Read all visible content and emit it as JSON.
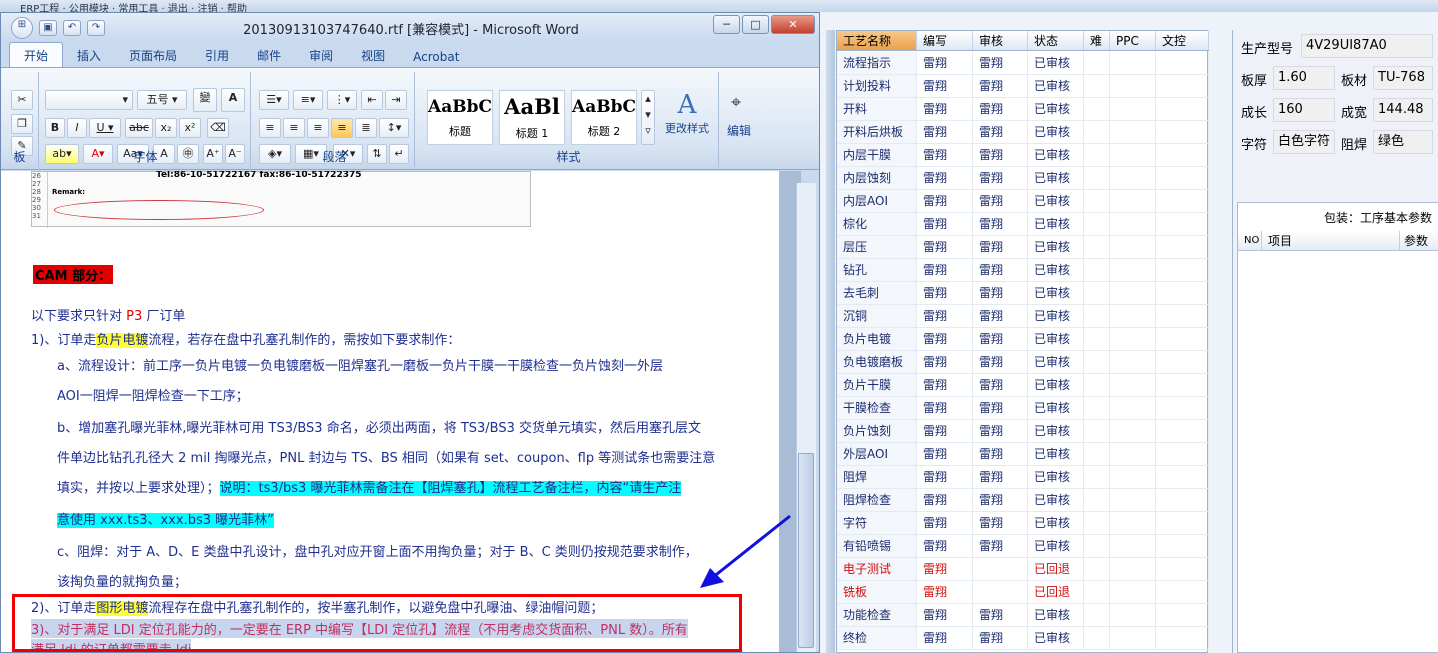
{
  "window": {
    "title": "20130913103747640.rtf [兼容模式] - Microsoft Word",
    "min": "─",
    "max": "□",
    "close": "✕"
  },
  "bg_menu": "ERP工程 · 公用模块 · 常用工具 · 退出 · 注销 · 帮助",
  "tabs": [
    "开始",
    "插入",
    "页面布局",
    "引用",
    "邮件",
    "审阅",
    "视图",
    "Acrobat"
  ],
  "ribbon": {
    "font_size": "五号",
    "groups": {
      "font": "字体",
      "paragraph": "段落",
      "styles": "样式",
      "clipboard": "板",
      "edit": "编辑"
    },
    "styles": [
      {
        "preview": "AaBbC",
        "name": "标题"
      },
      {
        "preview": "AaBl",
        "name": "标题 1"
      },
      {
        "preview": "AaBbC",
        "name": "标题 2"
      }
    ],
    "change_styles": "更改样式",
    "edit_label": "编辑"
  },
  "doc": {
    "table_row1": "Tel:86-10-51722167 fax:86-10-51722375",
    "remark": "Remark:",
    "rownums": [
      "26",
      "27",
      "28",
      "29",
      "30",
      "31"
    ],
    "cam_title": "CAM 部分：",
    "line_p3_a": "以下要求只针对 ",
    "line_p3_b": "P3",
    "line_p3_c": " 厂订单",
    "l1_a": "1)、订单走",
    "l1_hl": "负片电镀",
    "l1_b": "流程，若存在盘中孔塞孔制作的，需按如下要求制作：",
    "la1": "a、流程设计：前工序一负片电镀一负电镀磨板一阻焊塞孔一磨板一负片干膜一干膜检查一负片蚀刻一外层",
    "la2": "AOI一阻焊一阻焊检查一下工序；",
    "lb1": "b、增加塞孔曝光菲林,曝光菲林可用 TS3/BS3 命名，必须出两面，将 TS3/BS3 交货单元填实，然后用塞孔层文",
    "lb2": "件单边比钻孔孔径大 2 mil 掏曝光点，PNL 封边与 TS、BS 相同（如果有 set、coupon、flp 等测试条也需要注意",
    "lb3_a": "填实，并按以上要求处理）；",
    "lb3_hl": "说明：ts3/bs3 曝光菲林需备注在【阻焊塞孔】流程工艺备注栏，内容“请生产注",
    "lb4_hl": "意使用 xxx.ts3、xxx.bs3 曝光菲林”",
    "lc1": "c、阻焊：对于 A、D、E 类盘中孔设计，盘中孔对应开窗上面不用掏负量；对于 B、C 类则仍按规范要求制作，",
    "lc2": "该掏负量的就掏负量；",
    "l2_a": "2)、订单走",
    "l2_hl": "图形电镀",
    "l2_b": "流程存在盘中孔塞孔制作的，按半塞孔制作，以避免盘中孔曝油、绿油帽问题；",
    "l3_1": "3)、对于满足 LDI 定位孔能力的，一定要在 ERP 中编写【LDI 定位孔】流程（不用考虑交货面积、PNL 数）。所有",
    "l3_2": "满足 ldi 的订单都需要走 ldi"
  },
  "process_table": {
    "headers": [
      "工艺名称",
      "编写",
      "审核",
      "状态",
      "难",
      "PPC",
      "文控"
    ],
    "rows": [
      [
        "流程指示",
        "雷翔",
        "雷翔",
        "已审核"
      ],
      [
        "计划投料",
        "雷翔",
        "雷翔",
        "已审核"
      ],
      [
        "开料",
        "雷翔",
        "雷翔",
        "已审核"
      ],
      [
        "开料后烘板",
        "雷翔",
        "雷翔",
        "已审核"
      ],
      [
        "内层干膜",
        "雷翔",
        "雷翔",
        "已审核"
      ],
      [
        "内层蚀刻",
        "雷翔",
        "雷翔",
        "已审核"
      ],
      [
        "内层AOI",
        "雷翔",
        "雷翔",
        "已审核"
      ],
      [
        "棕化",
        "雷翔",
        "雷翔",
        "已审核"
      ],
      [
        "层压",
        "雷翔",
        "雷翔",
        "已审核"
      ],
      [
        "钻孔",
        "雷翔",
        "雷翔",
        "已审核"
      ],
      [
        "去毛刺",
        "雷翔",
        "雷翔",
        "已审核"
      ],
      [
        "沉铜",
        "雷翔",
        "雷翔",
        "已审核"
      ],
      [
        "负片电镀",
        "雷翔",
        "雷翔",
        "已审核"
      ],
      [
        "负电镀磨板",
        "雷翔",
        "雷翔",
        "已审核"
      ],
      [
        "负片干膜",
        "雷翔",
        "雷翔",
        "已审核"
      ],
      [
        "干膜检查",
        "雷翔",
        "雷翔",
        "已审核"
      ],
      [
        "负片蚀刻",
        "雷翔",
        "雷翔",
        "已审核"
      ],
      [
        "外层AOI",
        "雷翔",
        "雷翔",
        "已审核"
      ],
      [
        "阻焊",
        "雷翔",
        "雷翔",
        "已审核"
      ],
      [
        "阻焊检查",
        "雷翔",
        "雷翔",
        "已审核"
      ],
      [
        "字符",
        "雷翔",
        "雷翔",
        "已审核"
      ],
      [
        "有铅喷锡",
        "雷翔",
        "雷翔",
        "已审核"
      ],
      [
        "电子测试",
        "雷翔",
        "",
        "已回退"
      ],
      [
        "铣板",
        "雷翔",
        "",
        "已回退"
      ],
      [
        "功能检查",
        "雷翔",
        "雷翔",
        "已审核"
      ],
      [
        "终检",
        "雷翔",
        "雷翔",
        "已审核"
      ]
    ]
  },
  "product": {
    "model_label": "生产型号",
    "model": "4V29UI87A0",
    "thick_label": "板厚",
    "thick": "1.60",
    "material_label": "板材",
    "material": "TU-768",
    "len_label": "成长",
    "len": "160",
    "width_label": "成宽",
    "width": "144.48",
    "char_label": "字符",
    "char": "白色字符",
    "solder_label": "阻焊",
    "solder": "绿色"
  },
  "package": {
    "title": "包装：工序基本参数",
    "col_no": "NO",
    "col_item": "项目",
    "col_param": "参数"
  }
}
